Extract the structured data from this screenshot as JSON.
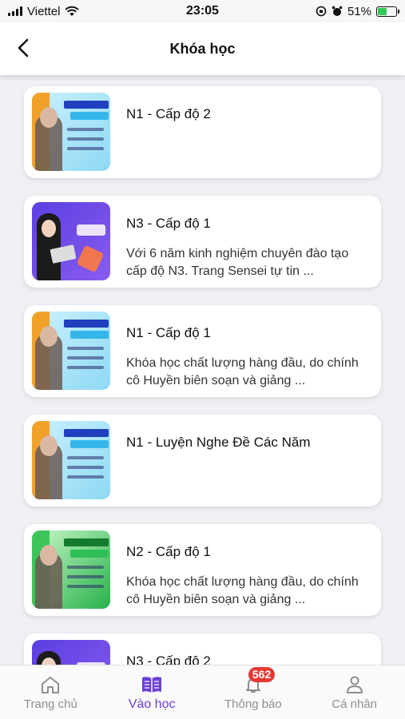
{
  "status_bar": {
    "carrier": "Viettel",
    "time": "23:05",
    "battery": "51%",
    "battery_level": 0.51
  },
  "header": {
    "title": "Khóa học",
    "back_icon": "chevron-left-icon"
  },
  "courses": [
    {
      "title": "N1 - Cấp độ 2",
      "description": "",
      "thumb_style": "cyan"
    },
    {
      "title": "N3 - Cấp độ 1",
      "description": "Với 6 năm kinh nghiệm chuyên đào tạo cấp độ N3. Trang Sensei tự tin ...",
      "thumb_style": "purple"
    },
    {
      "title": "N1 - Cấp độ 1",
      "description": "Khóa học chất lượng hàng đầu, do chính cô Huyền biên soạn và giảng ...",
      "thumb_style": "cyan"
    },
    {
      "title": "N1 - Luyện Nghe Đề Các Năm",
      "description": "",
      "thumb_style": "cyan"
    },
    {
      "title": "N2 - Cấp độ 1",
      "description": "Khóa học chất lượng hàng đầu, do chính cô Huyền biên soạn và giảng ...",
      "thumb_style": "green"
    },
    {
      "title": "N3 - Cấp độ 2",
      "description": "",
      "thumb_style": "purple"
    }
  ],
  "tabbar": {
    "items": [
      {
        "label": "Trang chủ",
        "icon": "home-icon",
        "active": false
      },
      {
        "label": "Vào học",
        "icon": "book-icon",
        "active": true
      },
      {
        "label": "Thông báo",
        "icon": "bell-icon",
        "active": false,
        "badge": "562"
      },
      {
        "label": "Cá nhân",
        "icon": "user-icon",
        "active": false
      }
    ]
  },
  "colors": {
    "accent": "#6c3fd6",
    "badge": "#e53935",
    "inactive": "#8e8e93",
    "battery": "#34c759"
  }
}
